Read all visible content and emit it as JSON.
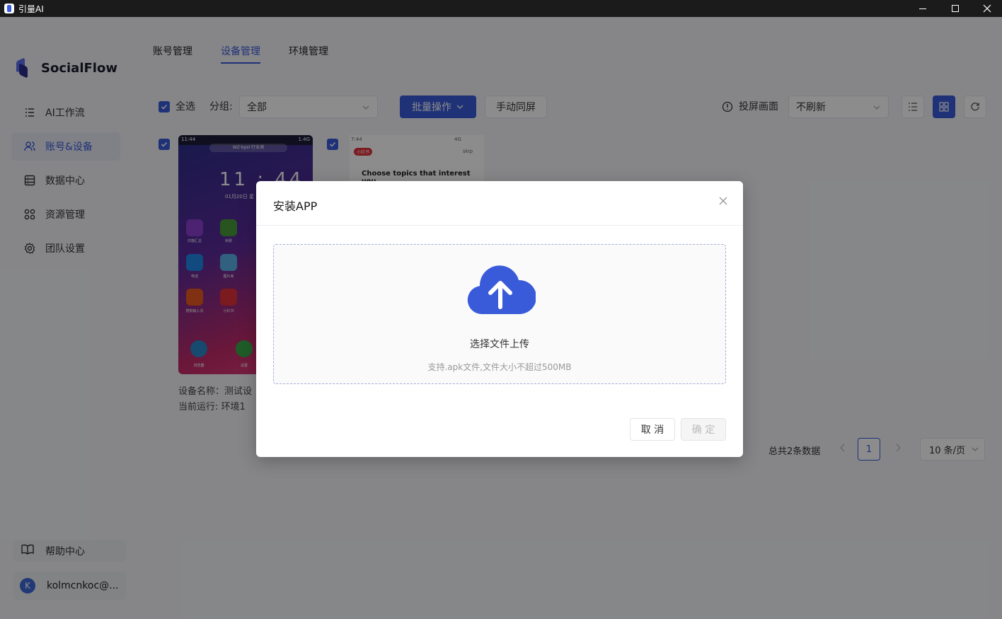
{
  "window": {
    "title": "引量AI",
    "minimize_icon": "minimize-icon",
    "maximize_icon": "maximize-icon",
    "close_icon": "close-icon"
  },
  "sidebar": {
    "brand": "SocialFlow",
    "items": [
      {
        "label": "AI工作流",
        "icon": "workflow-icon",
        "active": false
      },
      {
        "label": "账号&设备",
        "icon": "users-icon",
        "active": true
      },
      {
        "label": "数据中心",
        "icon": "data-icon",
        "active": false
      },
      {
        "label": "资源管理",
        "icon": "grid-icon",
        "active": false
      },
      {
        "label": "团队设置",
        "icon": "gear-icon",
        "active": false
      }
    ],
    "help": "帮助中心",
    "user": {
      "avatar_letter": "K",
      "name": "kolmcnkoc@..."
    }
  },
  "tabs": [
    {
      "label": "账号管理",
      "active": false
    },
    {
      "label": "设备管理",
      "active": true
    },
    {
      "label": "环境管理",
      "active": false
    }
  ],
  "toolbar": {
    "select_all": "全选",
    "group_label": "分组:",
    "group_value": "全部",
    "batch_button": "批量操作",
    "sync_button": "手动同屏",
    "cast_label": "投屏画面",
    "refresh_value": "不刷新"
  },
  "devices": [
    {
      "status_time": "11:44",
      "status_net": "1.4G",
      "top_text": "WZ·bpsl·行业测",
      "clock": "11 : 44",
      "date": "01月20日 星",
      "apps": [
        {
          "label": "扫描汇总",
          "color": "#8a3fd0"
        },
        {
          "label": "桥梁",
          "color": "#4a9a3a"
        },
        {
          "label": "电话",
          "color": "#1e88e5"
        },
        {
          "label": "图片库",
          "color": "#5bb0e8"
        },
        {
          "label": "搜狗输入法",
          "color": "#e85a20"
        },
        {
          "label": "小红书",
          "color": "#e0303a"
        },
        {
          "label": "浏览器",
          "color": "#2a88c8"
        },
        {
          "label": "设置",
          "color": "#3aa84a"
        }
      ],
      "name_label": "设备名称：测试设",
      "running_label": "当前运行: 环境1"
    },
    {
      "status_time": "7:44",
      "status_net": "4G",
      "tag": "小红书",
      "skip": "skip",
      "question": "Choose topics that interest you"
    }
  ],
  "pagination": {
    "total": "总共2条数据",
    "page": "1",
    "page_size": "10 条/页"
  },
  "modal": {
    "title": "安装APP",
    "upload_title": "选择文件上传",
    "upload_hint": "支持.apk文件,文件大小不超过500MB",
    "cancel": "取 消",
    "ok": "确 定",
    "upload_icon": "cloud-upload-icon",
    "accent": "#3a5bd9"
  }
}
